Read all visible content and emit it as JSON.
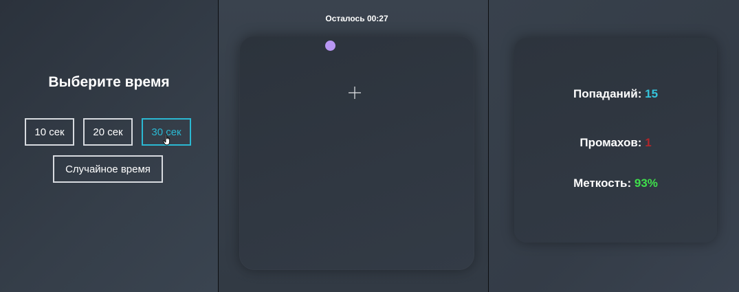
{
  "left_panel": {
    "title": "Выберите время",
    "buttons": [
      {
        "label": "10 сек",
        "selected": false
      },
      {
        "label": "20 сек",
        "selected": false
      },
      {
        "label": "30 сек",
        "selected": true
      },
      {
        "label": "Случайное время",
        "selected": false
      }
    ]
  },
  "game_panel": {
    "timer_label": "Осталось 00:27",
    "target_color": "#b896f3"
  },
  "stats_panel": {
    "hits_label": "Попаданий:",
    "hits_value": "15",
    "misses_label": "Промахов:",
    "misses_value": "1",
    "accuracy_label": "Меткость:",
    "accuracy_value": "93%"
  },
  "colors": {
    "accent": "#2bb9d3",
    "hits": "#35c4dc",
    "misses": "#b1262a",
    "accuracy": "#3fe04b"
  }
}
